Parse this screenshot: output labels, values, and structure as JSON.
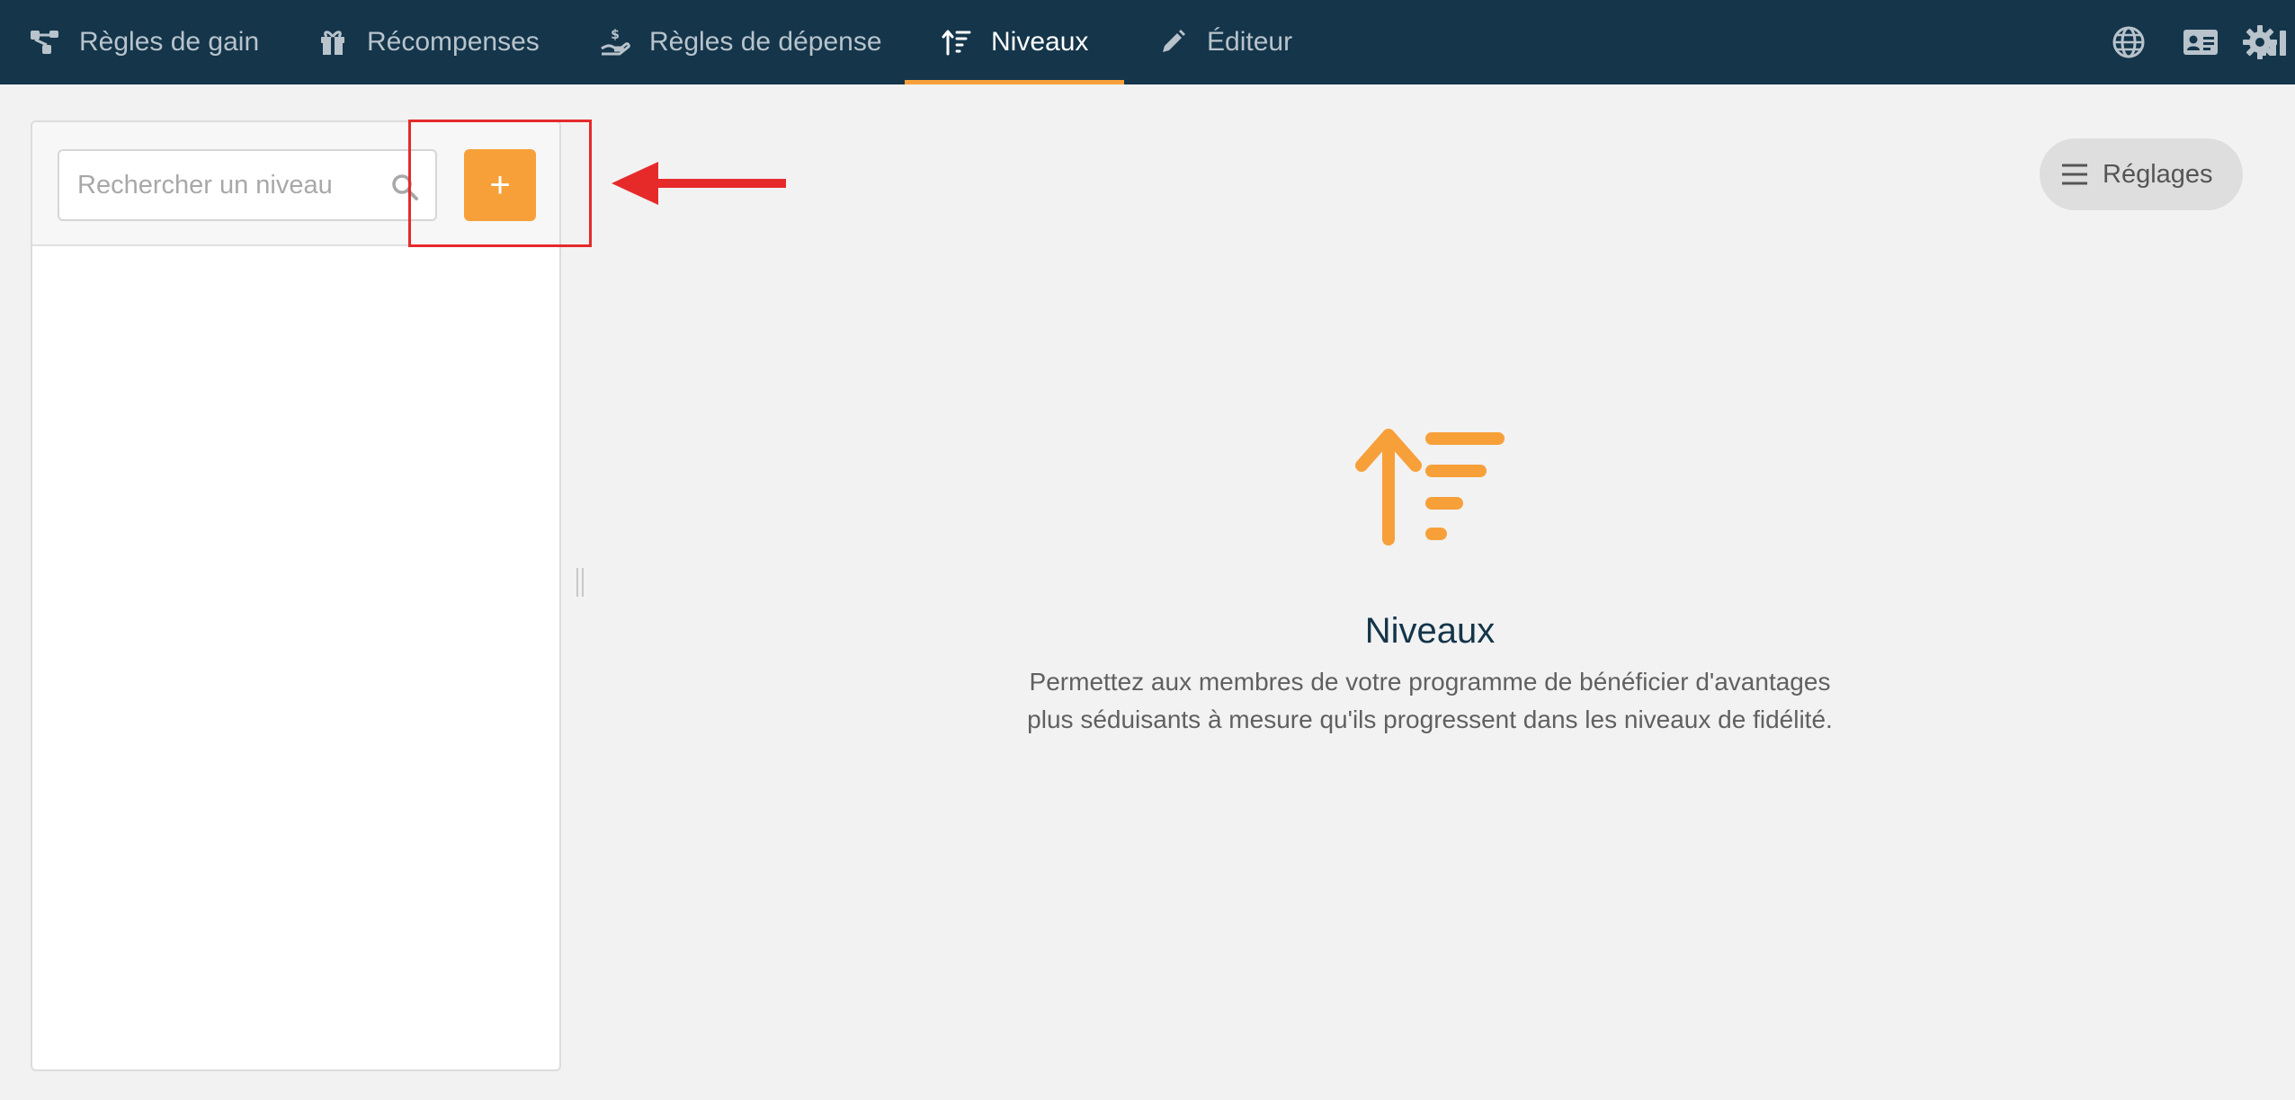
{
  "nav": {
    "tabs": [
      {
        "label": "Règles de gain",
        "icon": "earn-rules-icon"
      },
      {
        "label": "Récompenses",
        "icon": "gift-icon"
      },
      {
        "label": "Règles de dépense",
        "icon": "hand-coin-icon"
      },
      {
        "label": "Niveaux",
        "icon": "tiers-icon"
      },
      {
        "label": "Éditeur",
        "icon": "pencil-icon"
      }
    ],
    "active_tab": "Niveaux",
    "right_icons": [
      "globe-icon",
      "id-card-icon",
      "bar-chart-icon",
      "gear-icon"
    ]
  },
  "sidebar": {
    "search_placeholder": "Rechercher un niveau",
    "add_label": "+"
  },
  "settings": {
    "label": "Réglages"
  },
  "empty_state": {
    "title": "Niveaux",
    "description": "Permettez aux membres de votre programme de bénéficier d'avantages plus séduisants à mesure qu'ils progressent dans les niveaux de fidélité."
  },
  "colors": {
    "nav_bg": "#14354a",
    "accent": "#f7a03a",
    "annotation": "#e62a2a"
  }
}
